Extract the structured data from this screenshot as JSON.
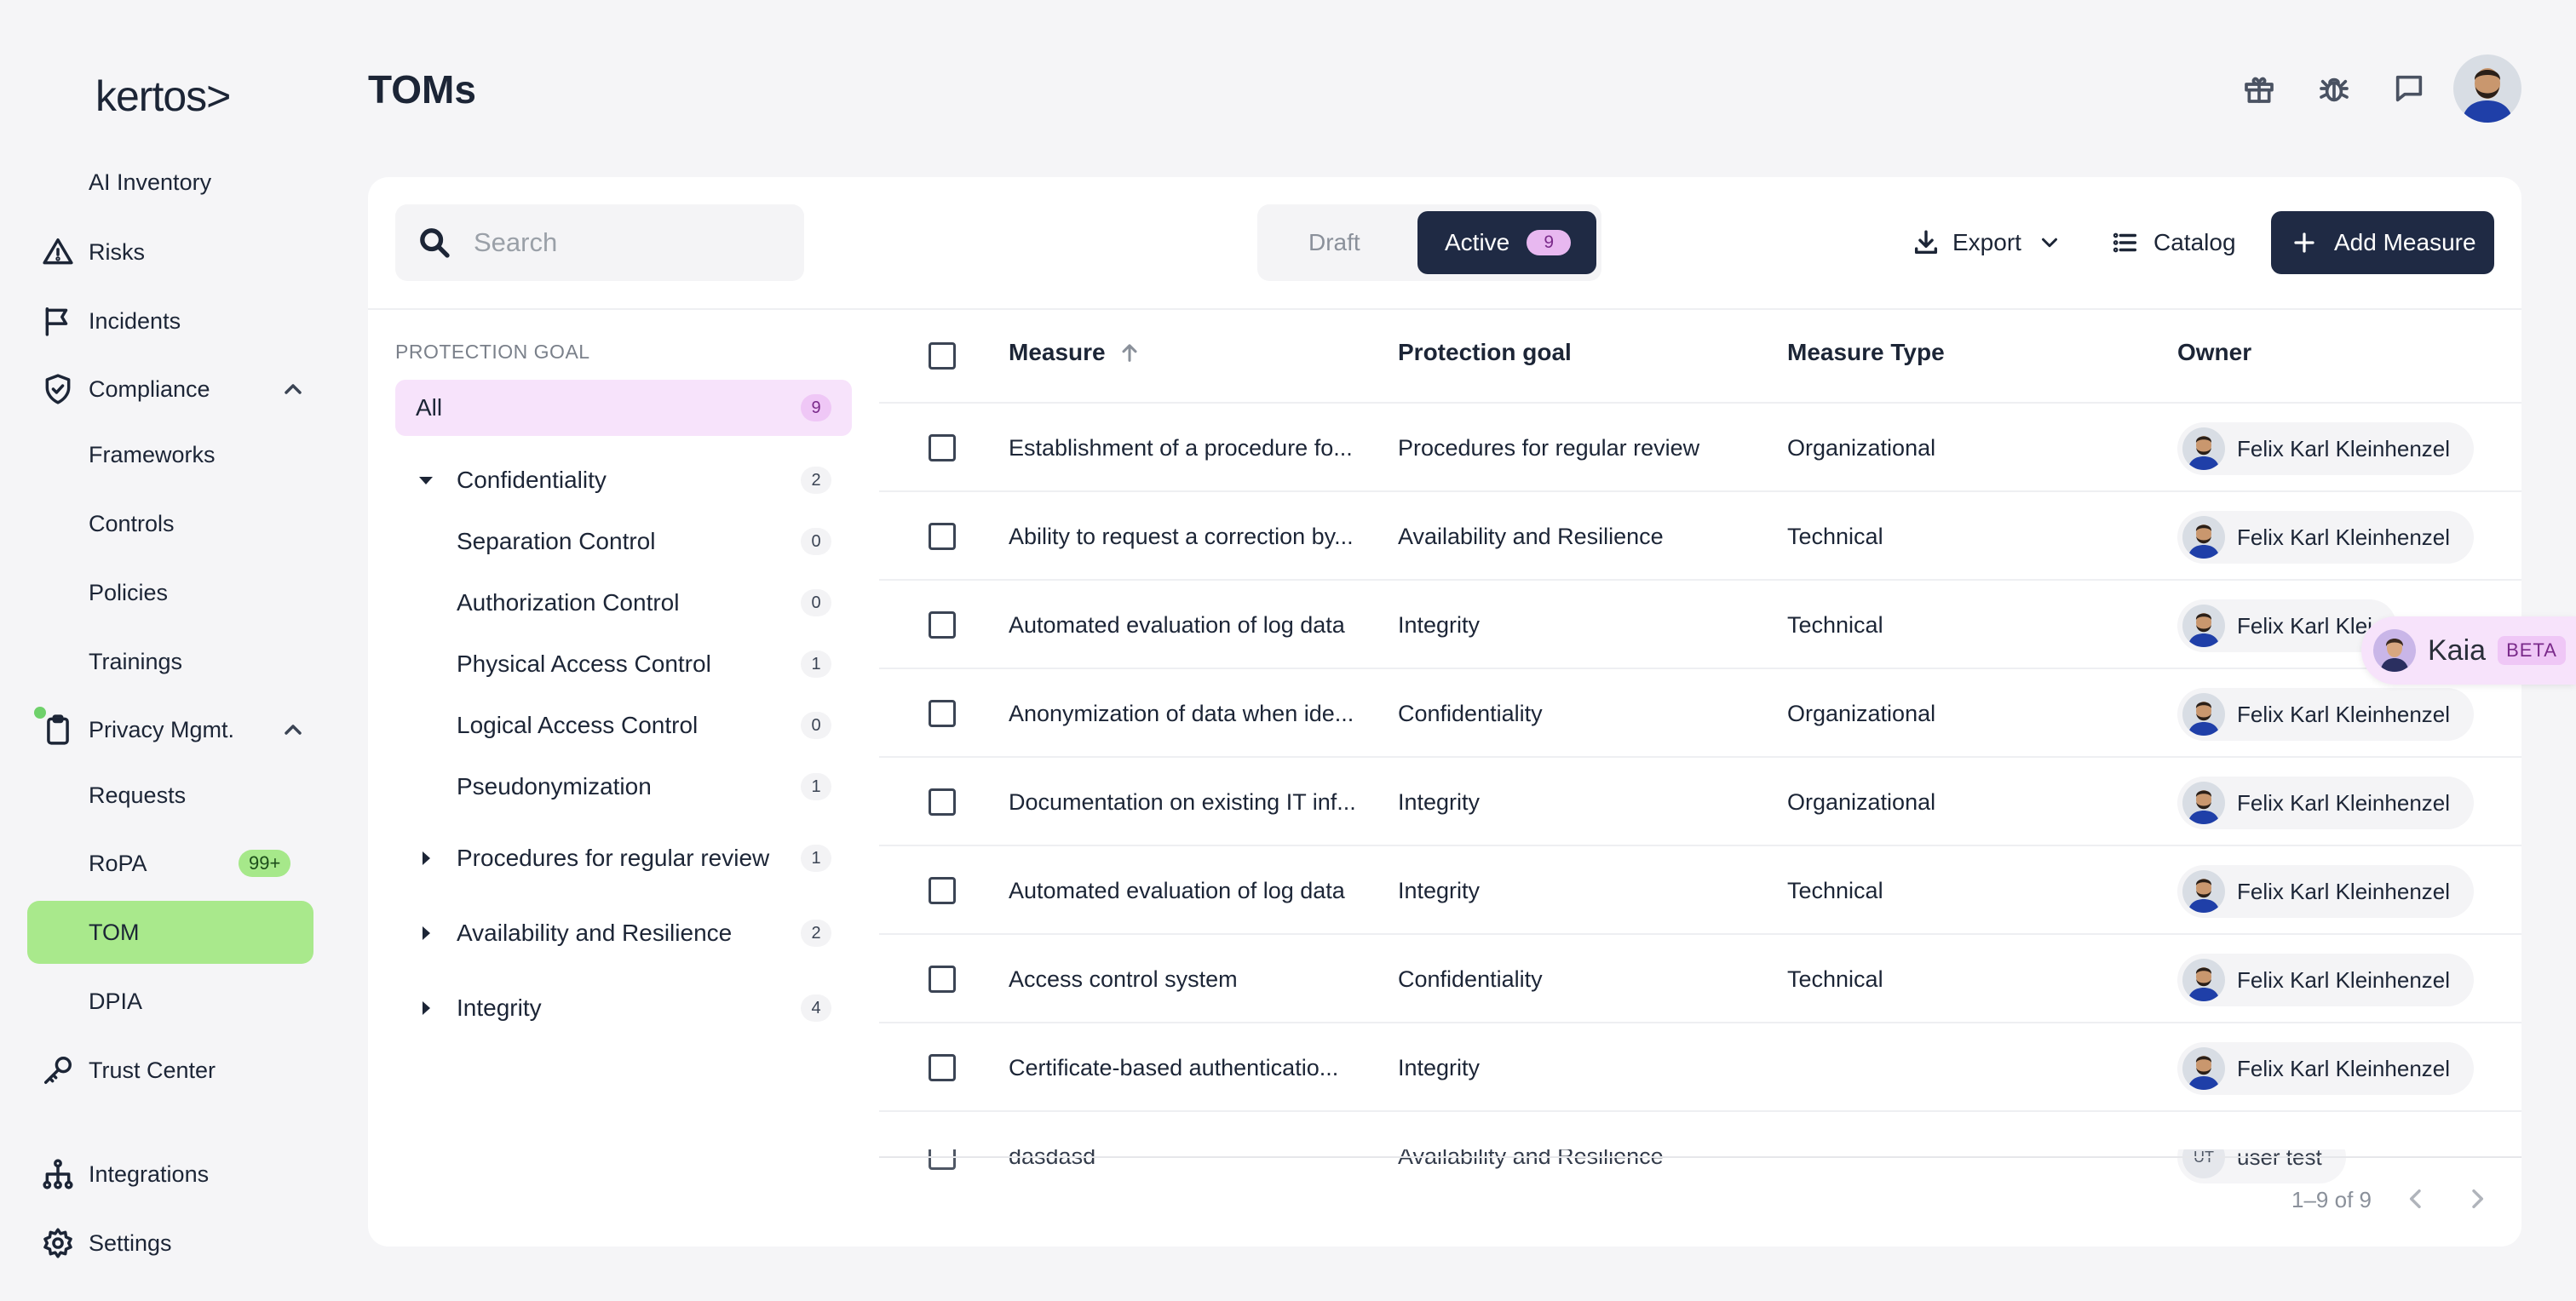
{
  "app": {
    "logo": "kertos>",
    "page_title": "TOMs"
  },
  "sidebar": {
    "items": [
      {
        "label": "AI Inventory"
      },
      {
        "label": "Risks",
        "icon": "warning-icon"
      },
      {
        "label": "Incidents",
        "icon": "flag-icon"
      },
      {
        "label": "Compliance",
        "icon": "shield-check-icon",
        "expanded": true
      },
      {
        "label": "Frameworks"
      },
      {
        "label": "Controls"
      },
      {
        "label": "Policies"
      },
      {
        "label": "Trainings"
      },
      {
        "label": "Privacy Mgmt.",
        "icon": "clipboard-icon",
        "expanded": true
      },
      {
        "label": "Requests"
      },
      {
        "label": "RoPA",
        "badge": "99+"
      },
      {
        "label": "TOM",
        "active": true
      },
      {
        "label": "DPIA"
      },
      {
        "label": "Trust Center",
        "icon": "key-icon"
      },
      {
        "label": "Integrations",
        "icon": "hierarchy-icon"
      },
      {
        "label": "Settings",
        "icon": "gear-icon"
      }
    ]
  },
  "header_icons": [
    "gift-icon",
    "bug-icon",
    "chat-icon",
    "avatar"
  ],
  "toolbar": {
    "search_placeholder": "Search",
    "tab_draft": "Draft",
    "tab_active": "Active",
    "active_count": "9",
    "export_label": "Export",
    "catalog_label": "Catalog",
    "add_label": "Add Measure"
  },
  "protection_goal": {
    "header": "PROTECTION GOAL",
    "all_label": "All",
    "all_count": "9",
    "nodes": [
      {
        "label": "Confidentiality",
        "count": "2",
        "expanded": true
      },
      {
        "label": "Separation Control",
        "count": "0"
      },
      {
        "label": "Authorization Control",
        "count": "0"
      },
      {
        "label": "Physical Access Control",
        "count": "1"
      },
      {
        "label": "Logical Access Control",
        "count": "0"
      },
      {
        "label": "Pseudonymization",
        "count": "1"
      },
      {
        "label": "Procedures for regular review",
        "count": "1"
      },
      {
        "label": "Availability and Resilience",
        "count": "2"
      },
      {
        "label": "Integrity",
        "count": "4"
      }
    ]
  },
  "table": {
    "columns": [
      "Measure",
      "Protection goal",
      "Measure Type",
      "Owner"
    ],
    "rows": [
      {
        "measure": "Establishment of a procedure fo...",
        "goal": "Procedures for regular review",
        "type": "Organizational",
        "owner": "Felix Karl Kleinhenzel"
      },
      {
        "measure": "Ability to request a correction by...",
        "goal": "Availability and Resilience",
        "type": "Technical",
        "owner": "Felix Karl Kleinhenzel"
      },
      {
        "measure": "Automated evaluation of log data",
        "goal": "Integrity",
        "type": "Technical",
        "owner": "Felix Karl Klei"
      },
      {
        "measure": "Anonymization of data when ide...",
        "goal": "Confidentiality",
        "type": "Organizational",
        "owner": "Felix Karl Kleinhenzel"
      },
      {
        "measure": "Documentation on existing IT inf...",
        "goal": "Integrity",
        "type": "Organizational",
        "owner": "Felix Karl Kleinhenzel"
      },
      {
        "measure": "Automated evaluation of log data",
        "goal": "Integrity",
        "type": "Technical",
        "owner": "Felix Karl Kleinhenzel"
      },
      {
        "measure": "Access control system",
        "goal": "Confidentiality",
        "type": "Technical",
        "owner": "Felix Karl Kleinhenzel"
      },
      {
        "measure": "Certificate-based authenticatio...",
        "goal": "Integrity",
        "type": "",
        "owner": "Felix Karl Kleinhenzel"
      },
      {
        "measure": "dasdasd",
        "goal": "Availability and Resilience",
        "type": "",
        "owner": "user test",
        "owner_initials": "UT"
      }
    ]
  },
  "kaia": {
    "label": "Kaia",
    "badge": "BETA"
  },
  "pagination": {
    "range": "1–9 of 9"
  },
  "colors": {
    "accent_green": "#a9e98c",
    "navy": "#1f2a44",
    "pink_bg": "#f7e3fb"
  }
}
